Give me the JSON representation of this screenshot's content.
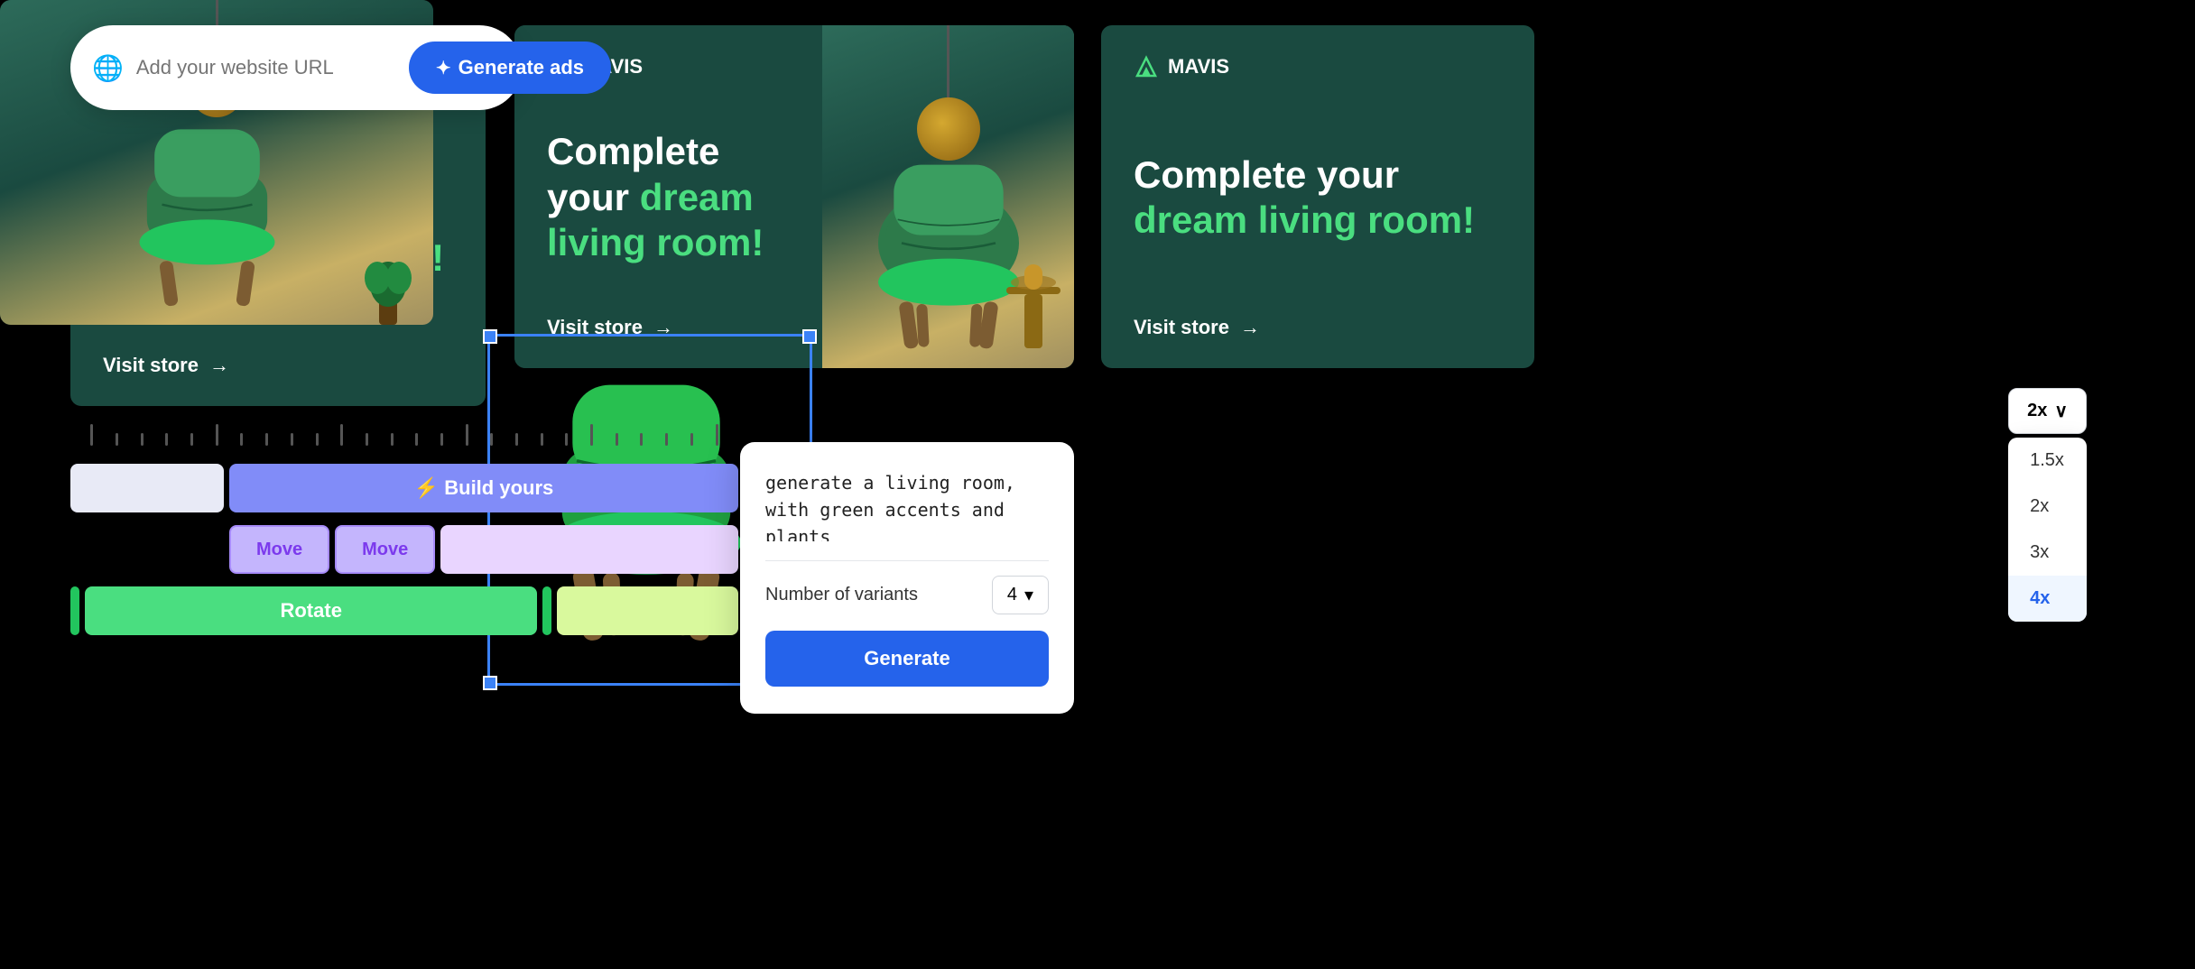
{
  "url_bar": {
    "placeholder": "Add your website URL",
    "generate_label": "Generate ads",
    "star_symbol": "✦"
  },
  "ad_cards": {
    "brand": "MAVIS",
    "headline_white": "Complete your ",
    "headline_green": "dream living room!",
    "cta": "Visit store",
    "cta_arrow": "→"
  },
  "timeline": {
    "build_label": "⚡ Build yours",
    "move_label": "Move",
    "rotate_label": "Rotate"
  },
  "generate_panel": {
    "prompt": "generate a living room, with green accents and plants",
    "variants_label": "Number of variants",
    "variants_value": "4",
    "dropdown_icon": "▾",
    "generate_label": "Generate"
  },
  "zoom_dropdown": {
    "current": "2x",
    "chevron": "∨",
    "options": [
      {
        "label": "1.5x",
        "active": false
      },
      {
        "label": "2x",
        "active": false
      },
      {
        "label": "3x",
        "active": false
      },
      {
        "label": "4x",
        "active": true
      }
    ]
  }
}
